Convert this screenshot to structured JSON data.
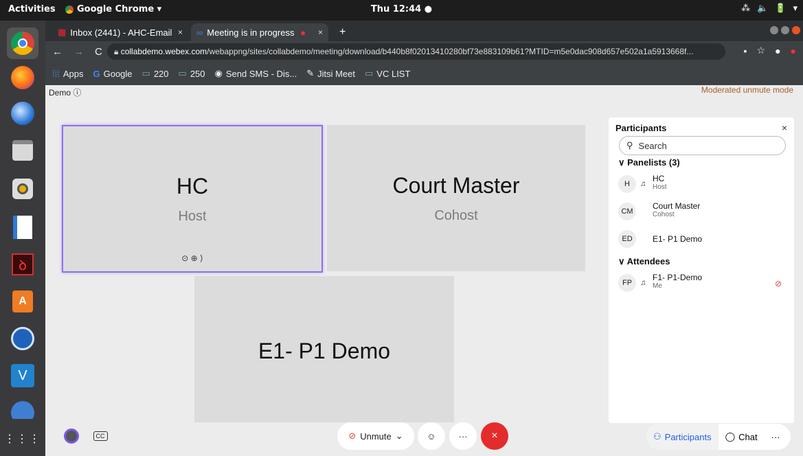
{
  "os": {
    "activities": "Activities",
    "app_menu": "Google Chrome ▾",
    "clock": "Thu 12:44 ●",
    "tray": [
      "⁂",
      "🔈",
      "🔋",
      "▾"
    ]
  },
  "browser": {
    "tabs": [
      {
        "label": "Inbox (2441) - AHC-Email",
        "close": "×"
      },
      {
        "label": "Meeting is in progress",
        "close": "×"
      }
    ],
    "new_tab": "+",
    "nav": {
      "back": "←",
      "forward": "→",
      "reload": "C"
    },
    "url_domain": "collabdemo.webex.com",
    "url_path": "/webappng/sites/collabdemo/meeting/download/b440b8f02013410280bf73e883109b61?MTID=m5e0dac908d657e502a1a5913668f...",
    "addr_icons": [
      "▪",
      "☆",
      "●",
      "●"
    ],
    "bookmarks": [
      "Apps",
      "Google",
      "220",
      "250",
      "Send SMS - Dis...",
      "Jitsi Meet",
      "VC LIST"
    ]
  },
  "meeting": {
    "title": "Demo ⓘ",
    "mode": "Moderated unmute mode",
    "tiles": [
      {
        "name": "HC",
        "role": "Host",
        "icons": "⊙ ⊕ ⟩"
      },
      {
        "name": "Court Master",
        "role": "Cohost"
      },
      {
        "name": "E1- P1 Demo",
        "role": ""
      }
    ]
  },
  "participants_panel": {
    "title": "Participants",
    "close": "×",
    "search_placeholder": "Search",
    "panelists_header": "∨  Panelists (3)",
    "attendees_header": "∨  Attendees",
    "panelists": [
      {
        "initials": "H",
        "name": "HC",
        "role": "Host"
      },
      {
        "initials": "CM",
        "name": "Court Master",
        "role": "Cohost"
      },
      {
        "initials": "ED",
        "name": "E1- P1 Demo",
        "role": ""
      }
    ],
    "attendees": [
      {
        "initials": "FP",
        "name": "F1- P1-Demo",
        "role": "Me"
      }
    ]
  },
  "controls": {
    "unmute": "Unmute",
    "unmute_caret": "⌄",
    "reactions": "☺",
    "more": "···",
    "end": "×",
    "participants_tab": "Participants",
    "chat_tab": "Chat",
    "more_right": "···"
  },
  "colors": {
    "accent": "#8f6ff2",
    "end": "#e52c2c",
    "link": "#235fe2",
    "mode": "#a6602d"
  }
}
